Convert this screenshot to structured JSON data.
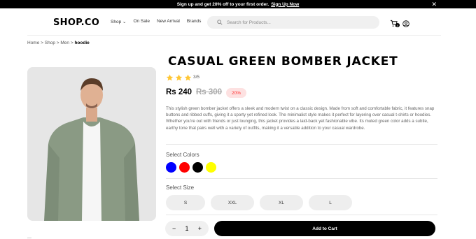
{
  "promo": {
    "text": "Sign up and get 20% off to your first order.",
    "link": "Sign Up Now"
  },
  "header": {
    "logo": "SHOP.CO",
    "nav": [
      "Shop",
      "On Sale",
      "New Arrival",
      "Brands"
    ],
    "search_placeholder": "Search for Products...",
    "cart_count": "0"
  },
  "breadcrumb": {
    "home": "Home",
    "shop": "Shop",
    "men": "Men",
    "current": "hoodie"
  },
  "product": {
    "title": "CASUAL GREEN BOMBER JACKET",
    "rating_text": "3/5",
    "rating_value": 3,
    "price": "Rs 240",
    "old_price": "Rs 300",
    "discount": "20%",
    "description": "This stylish green bomber jacket offers a sleek and modern twist on a classic design. Made from soft and comfortable fabric, it features snap buttons and ribbed cuffs, giving it a sporty yet refined look. The minimalist style makes it perfect for layering over casual t-shirts or hoodies. Whether you're out with friends or just lounging, this jacket provides a laid-back yet fashionable vibe. Its muted green color adds a subtle, earthy tone that pairs well with a variety of outfits, making it a versatile addition to your casual wardrobe."
  },
  "options": {
    "colors_label": "Select Colors",
    "colors": [
      "#0000ff",
      "#ff0000",
      "#000000",
      "#ffff00"
    ],
    "size_label": "Select Size",
    "sizes": [
      "S",
      "XXL",
      "XL",
      "L"
    ]
  },
  "purchase": {
    "quantity": "1",
    "add_to_cart": "Add to Cart"
  },
  "colors": {
    "star": "#ffc633",
    "discount_bg": "#fde1e1",
    "discount_text": "#ff3333",
    "jacket": "#8a9a84"
  }
}
